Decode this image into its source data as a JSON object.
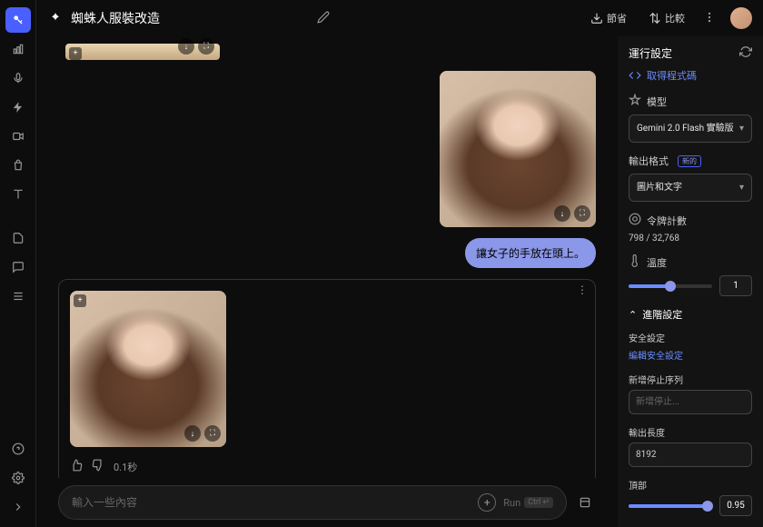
{
  "header": {
    "title": "蜘蛛人服裝改造",
    "save": "節省",
    "compare": "比較"
  },
  "chat": {
    "user_message": "讓女子的手放在頭上。",
    "response_time": "0.1秒",
    "input_placeholder": "輸入一些內容",
    "run_label": "Run",
    "run_shortcut": "Ctrl ↵"
  },
  "panel": {
    "title": "運行設定",
    "get_code": "取得程式碼",
    "model_label": "模型",
    "model_value": "Gemini 2.0 Flash 實驗版",
    "output_label": "輸出格式",
    "output_badge": "新的",
    "output_value": "圖片和文字",
    "tokens_label": "令牌計數",
    "tokens_value": "798 / 32,768",
    "temp_label": "溫度",
    "temp_value": "1",
    "advanced_label": "進階設定",
    "safety_label": "安全設定",
    "safety_link": "編輯安全設定",
    "stop_label": "新增停止序列",
    "stop_placeholder": "新增停止...",
    "length_label": "輸出長度",
    "length_value": "8192",
    "top_label": "頂部",
    "top_value": "0.95"
  }
}
